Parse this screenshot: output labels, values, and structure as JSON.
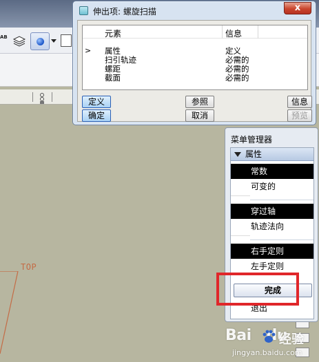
{
  "dialog": {
    "title": "伸出项: 螺旋扫描",
    "close_glyph": "x",
    "columns": {
      "element": "元素",
      "info": "信息"
    },
    "rows": [
      {
        "marker": ">",
        "name": "属性",
        "info": "定义"
      },
      {
        "marker": "",
        "name": "扫引轨迹",
        "info": "必需的"
      },
      {
        "marker": "",
        "name": "螺距",
        "info": "必需的"
      },
      {
        "marker": "",
        "name": "截面",
        "info": "必需的"
      }
    ],
    "buttons": {
      "define": "定义",
      "reference": "参照",
      "info": "信息",
      "ok": "确定",
      "cancel": "取消",
      "preview": "预览"
    }
  },
  "menu_manager": {
    "title": "菜单管理器",
    "section": "属性",
    "items": [
      {
        "label": "常数",
        "selected": true
      },
      {
        "label": "可变的",
        "selected": false
      },
      {
        "label": "穿过轴",
        "selected": true
      },
      {
        "label": "轨迹法向",
        "selected": false
      },
      {
        "label": "右手定则",
        "selected": true
      },
      {
        "label": "左手定则",
        "selected": false
      }
    ],
    "done": "完成",
    "exit": "退出"
  },
  "viewport": {
    "datum_label": "TOP"
  },
  "toolbar": {
    "ab_label": "AB"
  },
  "watermark": {
    "brand": "Bai",
    "brand2": "du",
    "suffix": "经验",
    "url": "jingyan.baidu.com"
  },
  "colors": {
    "highlight": "#e0262a",
    "selected_bg": "#000000",
    "datum": "#c46b45"
  }
}
